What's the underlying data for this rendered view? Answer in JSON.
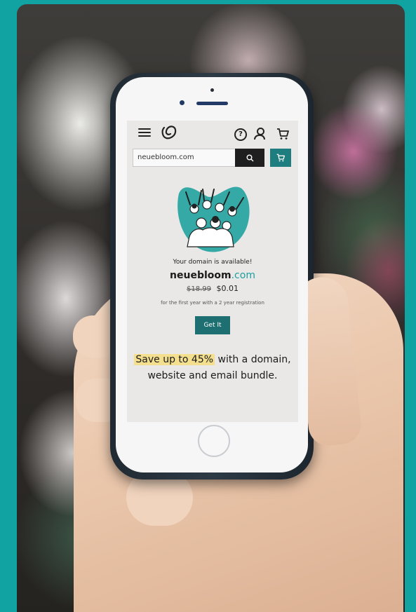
{
  "header": {
    "menu_icon": "hamburger-menu-icon",
    "logo_icon": "godaddy-logo-icon",
    "help_icon": "question-circle-icon",
    "account_icon": "user-icon",
    "cart_icon": "cart-icon"
  },
  "search": {
    "value": "neuebloom.com",
    "button_icon": "search-icon",
    "cart_button_icon": "cart-icon"
  },
  "result": {
    "availability": "Your domain is available!",
    "domain_base": "neuebloom",
    "domain_tld": ".com",
    "old_price": "$18.99",
    "new_price": "$0.01",
    "terms": "for the first year with a 2 year registration",
    "cta": "Get It"
  },
  "promo": {
    "highlight": "Save up to 45%",
    "rest": " with a domain, website and email bundle."
  },
  "colors": {
    "frame": "#10a3a2",
    "accent": "#1e6f72",
    "tld": "#1e9da0",
    "highlight": "#f3df8e"
  }
}
